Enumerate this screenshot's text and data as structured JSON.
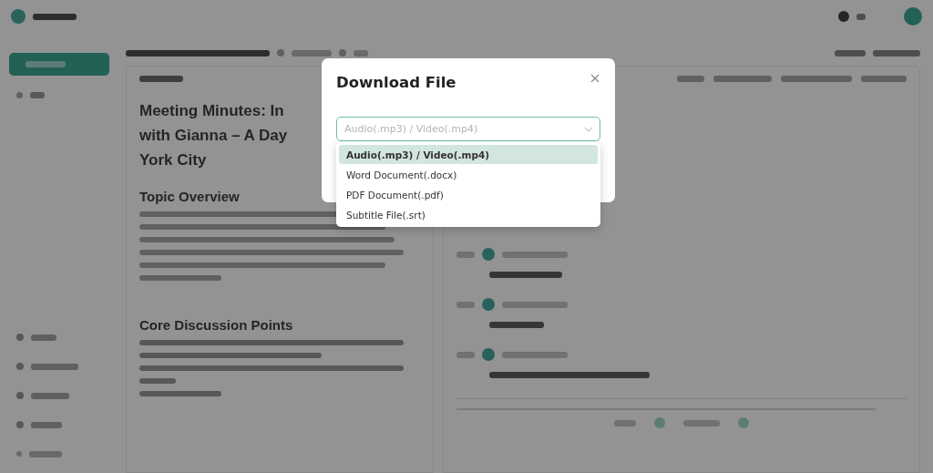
{
  "background": {
    "summary": {
      "heading_lines": [
        "Meeting Minutes: In",
        "with Gianna – A Day",
        "York City"
      ],
      "sections": [
        "Topic Overview",
        "Core Discussion Points"
      ]
    }
  },
  "dialog": {
    "title": "Download File",
    "select": {
      "placeholder": "Audio(.mp3) / Video(.mp4)",
      "expanded": true
    },
    "options": [
      {
        "label": "Audio(.mp3) / Video(.mp4)",
        "selected": true
      },
      {
        "label": "Word Document(.docx)",
        "selected": false
      },
      {
        "label": "PDF Document(.pdf)",
        "selected": false
      },
      {
        "label": "Subtitle File(.srt)",
        "selected": false
      }
    ]
  }
}
